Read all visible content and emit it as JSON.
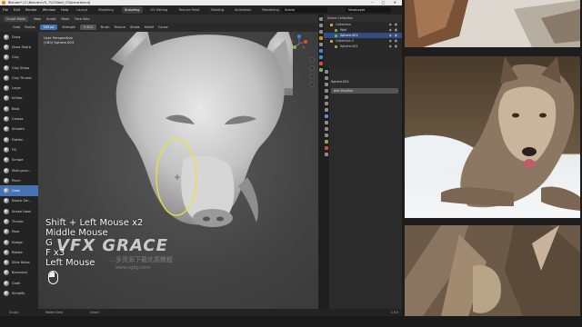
{
  "window": {
    "title": "Blender* [C:\\Blender\\VG_T\\07\\Wolf_07\\blend.blend]",
    "controls": "– ▢ ✕"
  },
  "menu": {
    "items": [
      "File",
      "Edit",
      "Render",
      "Window",
      "Help"
    ],
    "workspaces": [
      "Layout",
      "Modeling",
      "Sculpting",
      "UV Editing",
      "Texture Paint",
      "Shading",
      "Animation",
      "Rendering",
      "Compositing"
    ],
    "active_workspace_index": 2,
    "scene": "Scene",
    "view_layer": "ViewLayer"
  },
  "header": {
    "mode": "Sculpt Mode",
    "menus": [
      "View",
      "Sculpt",
      "Mask",
      "Face Sets"
    ]
  },
  "tool_header": {
    "brush": "Grab",
    "radius_label": "Radius",
    "radius_value": "169 px",
    "strength_label": "Strength",
    "strength_value": "0.400",
    "menus": [
      "Brush",
      "Texture",
      "Stroke",
      "Falloff",
      "Cursor"
    ]
  },
  "brushes": [
    {
      "label": "Draw"
    },
    {
      "label": "Draw Sharp"
    },
    {
      "label": "Clay"
    },
    {
      "label": "Clay Strips"
    },
    {
      "label": "Clay Thumb"
    },
    {
      "label": "Layer"
    },
    {
      "label": "Inflate"
    },
    {
      "label": "Blob"
    },
    {
      "label": "Crease"
    },
    {
      "label": "Smooth"
    },
    {
      "label": "Flatten"
    },
    {
      "label": "Fill"
    },
    {
      "label": "Scrape"
    },
    {
      "label": "Multi-plan..."
    },
    {
      "label": "Pinch"
    },
    {
      "label": "Grab"
    },
    {
      "label": "Elastic De..."
    },
    {
      "label": "Snake Hook"
    },
    {
      "label": "Thumb"
    },
    {
      "label": "Pose"
    },
    {
      "label": "Nudge"
    },
    {
      "label": "Rotate"
    },
    {
      "label": "Slide Relax"
    },
    {
      "label": "Boundary"
    },
    {
      "label": "Cloth"
    },
    {
      "label": "Simplify"
    }
  ],
  "active_brush_index": 15,
  "viewport": {
    "info_line1": "User Perspective",
    "info_line2": "(180) Sphere.003",
    "shortcut_lines": [
      "Shift + Left Mouse x2",
      "Middle Mouse",
      "G",
      "F x3",
      "Left Mouse"
    ]
  },
  "watermark": {
    "logo": "VFX GRACE",
    "cn": "…多资源下载优质教程",
    "url": "www.cgitg.com"
  },
  "outliner": {
    "header": "Scene Collection",
    "rows": [
      {
        "label": "Collection",
        "indent": 1,
        "selected": false
      },
      {
        "label": "Wolf",
        "indent": 2,
        "selected": false
      },
      {
        "label": "Sphere.003",
        "indent": 2,
        "selected": true
      },
      {
        "label": "Collection 2",
        "indent": 1,
        "selected": false
      },
      {
        "label": "Sphere.002",
        "indent": 2,
        "selected": false
      }
    ]
  },
  "properties": {
    "object": "Sphere.003",
    "add_modifier": "Add Modifier"
  },
  "status": {
    "items": [
      "Sculpt",
      "Rotate View",
      "Select"
    ],
    "version": "2.9.0"
  },
  "colors": {
    "accent": "#4772b3",
    "selection_ellipse": "#e9e23a"
  }
}
